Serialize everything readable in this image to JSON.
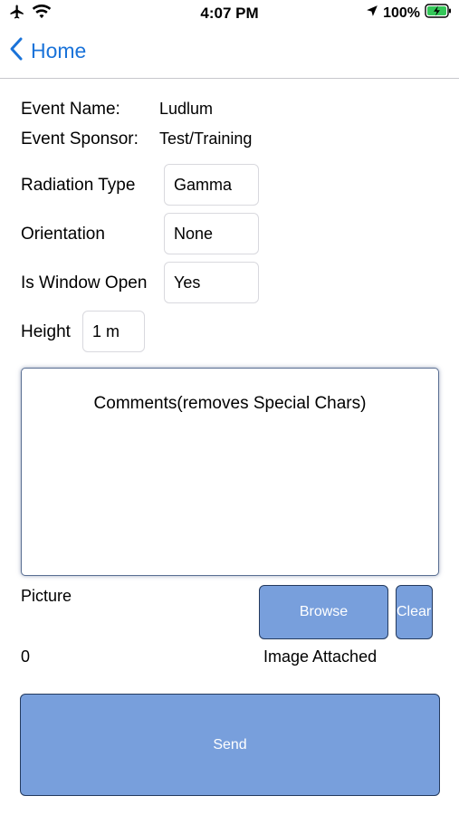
{
  "status_bar": {
    "time": "4:07 PM",
    "battery": "100%",
    "icons": [
      "airplane-icon",
      "wifi-icon",
      "location-arrow-icon",
      "battery-charging-icon"
    ]
  },
  "nav": {
    "back_label": "Home",
    "accent_color": "#1a73d9"
  },
  "form": {
    "event_name_label": "Event Name:",
    "event_name_value": "Ludlum",
    "event_sponsor_label": "Event Sponsor:",
    "event_sponsor_value": "Test/Training",
    "radiation_type_label": "Radiation Type",
    "radiation_type_value": "Gamma",
    "orientation_label": "Orientation",
    "orientation_value": "None",
    "window_open_label": "Is Window Open",
    "window_open_value": "Yes",
    "height_label": "Height",
    "height_value": "1 m",
    "comments_placeholder": "Comments(removes Special Chars)",
    "picture_label": "Picture",
    "picture_count": "0",
    "image_status": "Image Attached"
  },
  "buttons": {
    "browse_label": "Browse",
    "clear_label": "Clear",
    "send_label": "Send",
    "button_color": "#789fdc"
  }
}
